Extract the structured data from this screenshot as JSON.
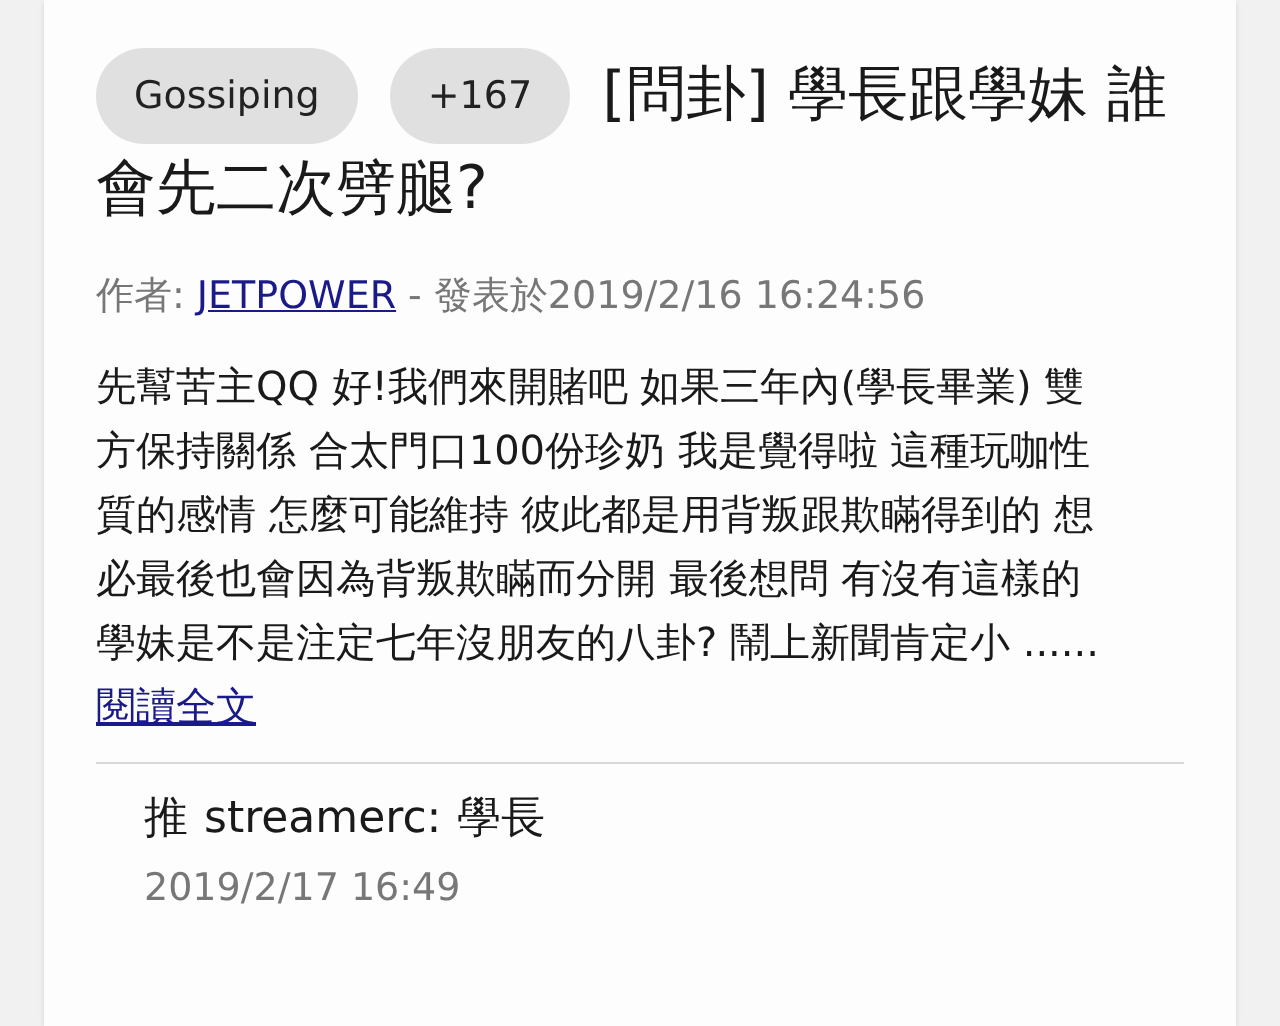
{
  "post": {
    "board": "Gossiping",
    "score": "+167",
    "title_lines": [
      "[問卦] 學長跟學妹 誰",
      "會先二次劈腿?"
    ],
    "author_label": "作者:",
    "author": "JETPOWER",
    "posted": "- 發表於2019/2/16 16:24:56",
    "body_lines": [
      "先幫苦主QQ 好!我們來開賭吧 如果三年內(學長畢業) 雙",
      "方保持關係 合太門口100份珍奶 我是覺得啦 這種玩咖性",
      "質的感情 怎麼可能維持 彼此都是用背叛跟欺瞞得到的 想",
      "必最後也會因為背叛欺瞞而分開 最後想問 有沒有這樣的",
      "學妹是不是注定七年沒朋友的八卦? 鬧上新聞肯定小 ......"
    ],
    "read_more": "閱讀全文"
  },
  "comments": [
    {
      "tag": "推",
      "user": "streamerc:",
      "text": "學長",
      "time": "2019/2/17 16:49"
    }
  ]
}
